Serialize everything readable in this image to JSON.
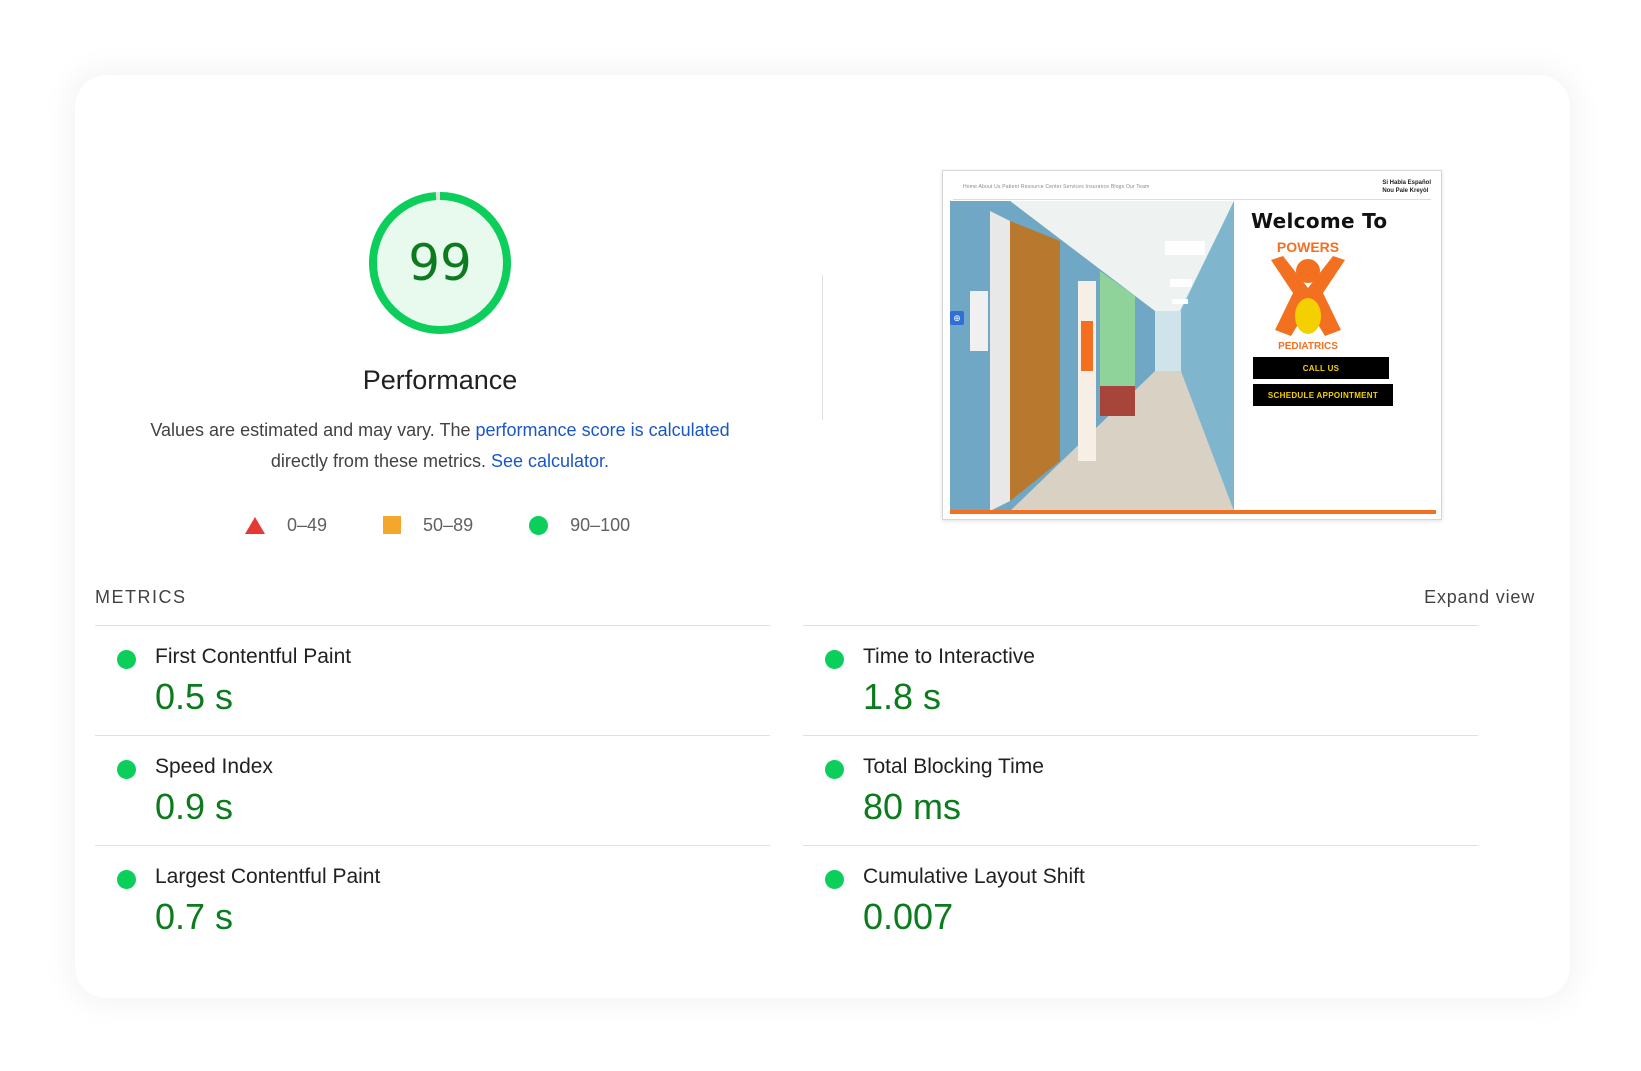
{
  "score": {
    "value": "99",
    "fraction": 0.99,
    "title": "Performance",
    "color": "#0cce5b"
  },
  "description": {
    "text1": "Values are estimated and may vary. The ",
    "link1": "performance score is calculated",
    "text2": " directly from these metrics. ",
    "link2": "See calculator."
  },
  "legend": [
    {
      "range": "0–49",
      "shape": "triangle",
      "color": "#e53935"
    },
    {
      "range": "50–89",
      "shape": "square",
      "color": "#f4a72d"
    },
    {
      "range": "90–100",
      "shape": "circle",
      "color": "#0cce5b"
    }
  ],
  "screenshot": {
    "nav_links": "Home  About Us  Patient Resource Center  Services  Insurance  Blogs  Our Team",
    "lang_line1": "Si Habla Español",
    "lang_line2": "Nou Pale Kreyòl",
    "welcome": "Welcome To",
    "logo_top": "POWERS",
    "logo_bottom": "PEDIATRICS",
    "call_button": "CALL US",
    "schedule_button": "SCHEDULE APPOINTMENT"
  },
  "metrics": {
    "header": "METRICS",
    "expand": "Expand view",
    "items": [
      {
        "label": "First Contentful Paint",
        "value": "0.5 s",
        "status": "good"
      },
      {
        "label": "Time to Interactive",
        "value": "1.8 s",
        "status": "good"
      },
      {
        "label": "Speed Index",
        "value": "0.9 s",
        "status": "good"
      },
      {
        "label": "Total Blocking Time",
        "value": "80 ms",
        "status": "good"
      },
      {
        "label": "Largest Contentful Paint",
        "value": "0.7 s",
        "status": "good"
      },
      {
        "label": "Cumulative Layout Shift",
        "value": "0.007",
        "status": "good"
      }
    ]
  }
}
